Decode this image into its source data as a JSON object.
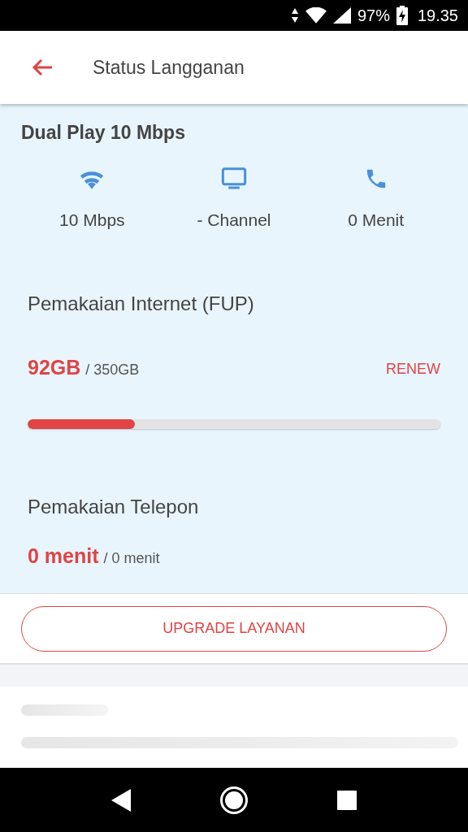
{
  "status_bar": {
    "battery": "97%",
    "time": "19.35"
  },
  "header": {
    "title": "Status Langganan"
  },
  "plan": {
    "name": "Dual Play 10 Mbps",
    "features": [
      {
        "kind": "wifi",
        "label": "10 Mbps"
      },
      {
        "kind": "tv",
        "label": "- Channel"
      },
      {
        "kind": "phone",
        "label": "0 Menit"
      }
    ]
  },
  "internet": {
    "title": "Pemakaian Internet (FUP)",
    "used": "92GB",
    "total": "/ 350GB",
    "action": "RENEW",
    "level": 0.26
  },
  "telephone": {
    "title": "Pemakaian Telepon",
    "used": "0 menit",
    "total": "/ 0 menit"
  },
  "upgrade_button": "UPGRADE LAYANAN"
}
